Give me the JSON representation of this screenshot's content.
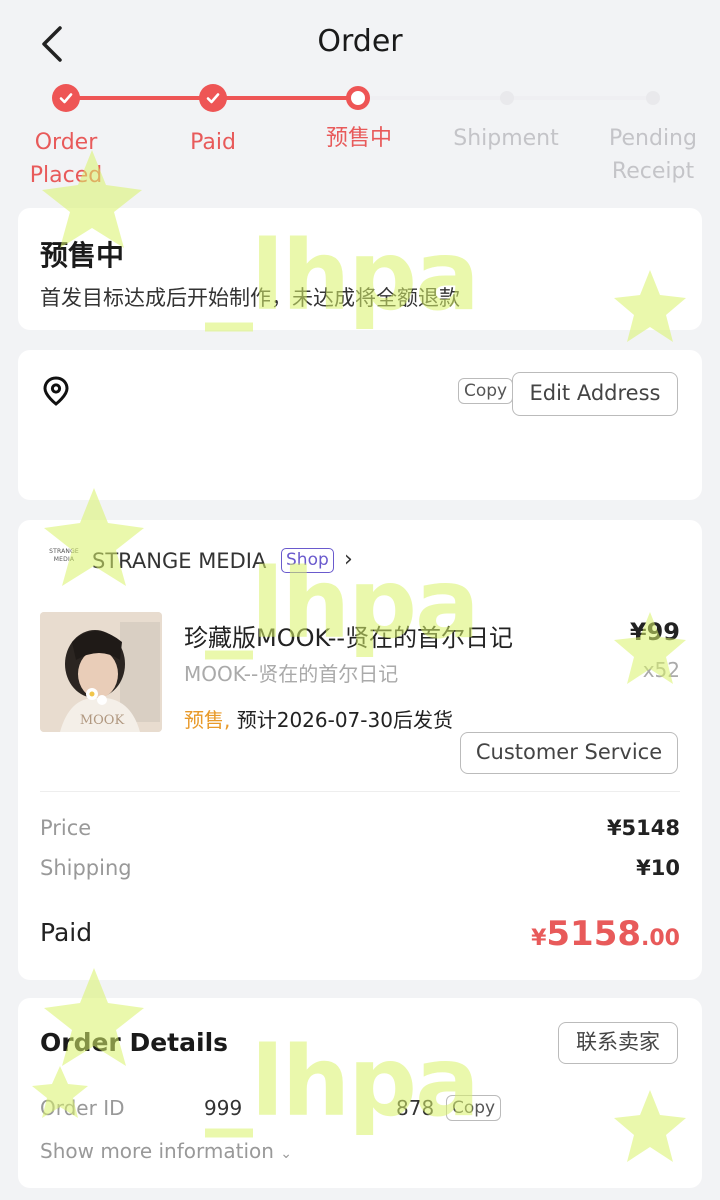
{
  "header": {
    "title": "Order"
  },
  "steps": [
    {
      "label": "Order\nPlaced",
      "state": "done"
    },
    {
      "label": "Paid",
      "state": "done"
    },
    {
      "label": "预售中",
      "state": "current"
    },
    {
      "label": "Shipment",
      "state": "pending"
    },
    {
      "label": "Pending\nReceipt",
      "state": "pending"
    }
  ],
  "status_card": {
    "title": "预售中",
    "description": "首发目标达成后开始制作，未达成将全额退款"
  },
  "address_card": {
    "copy_label": "Copy",
    "edit_label": "Edit Address"
  },
  "shop": {
    "logo_text": "STRANGE MEDIA",
    "name": "STRANGE MEDIA",
    "tag": "Shop",
    "chevron": "›"
  },
  "product": {
    "name": "珍藏版MOOK--贤在的首尔日记",
    "variant": "MOOK--贤在的首尔日记",
    "price": "¥99",
    "quantity": "x52",
    "presale_tag": "预售,",
    "ship_note": "预计2026-07-30后发货",
    "customer_service_label": "Customer Service"
  },
  "summary": {
    "price_label": "Price",
    "price_value": "¥5148",
    "shipping_label": "Shipping",
    "shipping_value": "¥10",
    "paid_label": "Paid",
    "paid_currency": "¥",
    "paid_integer": "5158",
    "paid_decimal": ".00"
  },
  "order_details": {
    "title": "Order Details",
    "contact_label": "联系卖家",
    "order_id_label": "Order ID",
    "order_id_part1": "999",
    "order_id_part2": "878",
    "copy_label": "Copy",
    "more_label": "Show more information"
  },
  "watermark": {
    "text": "_lhpa"
  },
  "colors": {
    "accent": "#ee5555",
    "presale_orange": "#e89a2a",
    "shop_tag": "#6a5acd",
    "watermark": "#d9f36a"
  }
}
